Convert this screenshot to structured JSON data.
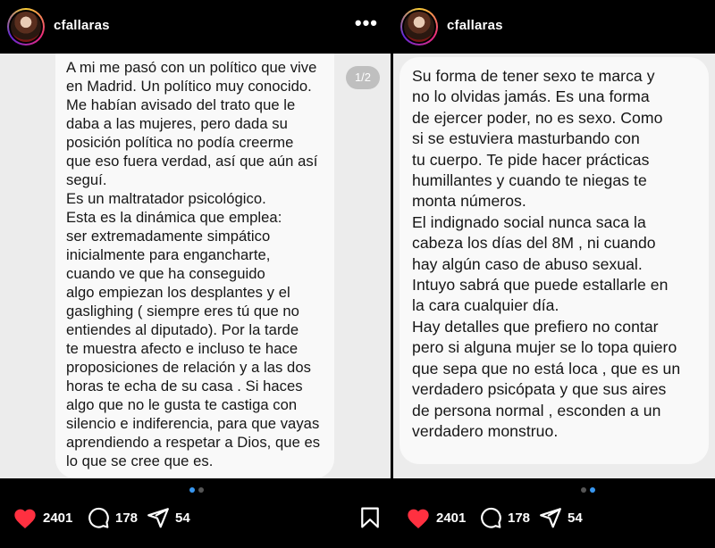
{
  "left_post": {
    "username": "cfallaras",
    "more_label": "•••",
    "page_indicator": "1/2",
    "text": "A mi me pasó con un político que vive\nen Madrid. Un político muy conocido.\nMe habían avisado del trato que le\ndaba a las mujeres, pero dada su\nposición política no podía creerme\nque eso fuera verdad, así que aún así\nseguí.\nEs un maltratador psicológico.\nEsta es la dinámica que emplea:\nser extremadamente simpático\ninicialmente para engancharte,\ncuando ve que ha conseguido\nalgo empiezan los desplantes y el\ngaslighing ( siempre eres tú que no\nentiendes al diputado). Por la tarde\nte muestra afecto e incluso te hace\nproposiciones de relación y a las dos\nhoras te echa de su casa . Si haces\nalgo que no le gusta te castiga con\nsilencio e indiferencia, para que vayas\naprendiendo a respetar a Dios, que es\nlo que se cree que es.",
    "likes": "2401",
    "comments": "178",
    "shares": "54",
    "active_slide": 1,
    "slides": 2
  },
  "right_post": {
    "username": "cfallaras",
    "text": "Su forma de tener sexo te marca y\nno lo olvidas jamás. Es una forma\nde ejercer poder, no es sexo. Como\nsi se estuviera masturbando con\ntu cuerpo. Te pide hacer prácticas\nhumillantes y cuando te niegas te\nmonta números.\nEl indignado social nunca saca la\ncabeza los días del 8M , ni cuando\nhay algún caso de abuso sexual.\nIntuyo sabrá que puede estallarle en\nla cara cualquier día.\nHay detalles que prefiero no contar\npero si alguna mujer se lo topa quiero\nque sepa que no está loca , que es un\nverdadero psicópata y que sus aires\nde persona normal , esconden a un\nverdadero monstruo.",
    "likes": "2401",
    "comments": "178",
    "shares": "54",
    "active_slide": 2,
    "slides": 2
  },
  "colors": {
    "like": "#ff3040",
    "dot_active": "#3897f0",
    "background": "#000000",
    "bubble": "#f9f9f9"
  },
  "icons": [
    "heart-icon",
    "comment-icon",
    "share-icon",
    "bookmark-icon",
    "more-icon"
  ]
}
